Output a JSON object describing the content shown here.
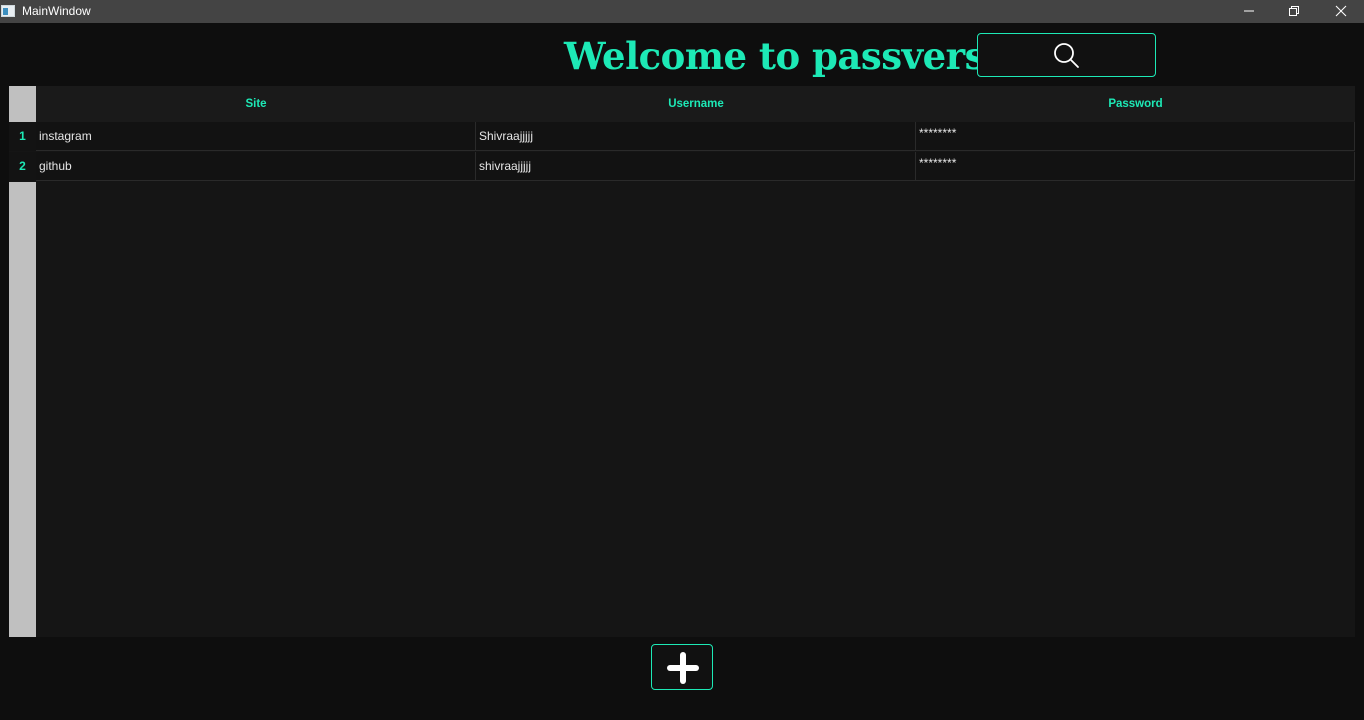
{
  "window": {
    "title": "MainWindow"
  },
  "heading": {
    "text": "Welcome to passverse"
  },
  "search": {
    "icon": "search-icon"
  },
  "table": {
    "columns": [
      "Site",
      "Username",
      "Password"
    ],
    "rows": [
      {
        "num": "1",
        "site": "instagram",
        "username": "Shivraajjjjj",
        "password": "********"
      },
      {
        "num": "2",
        "site": "github",
        "username": "shivraajjjjj",
        "password": "********"
      }
    ]
  },
  "add": {
    "icon": "plus-icon"
  },
  "colors": {
    "accent": "#1de9b6",
    "background": "#0e0e0e",
    "titlebar": "#444444",
    "table_bg": "#151515",
    "row_header": "#c0c0c0"
  }
}
